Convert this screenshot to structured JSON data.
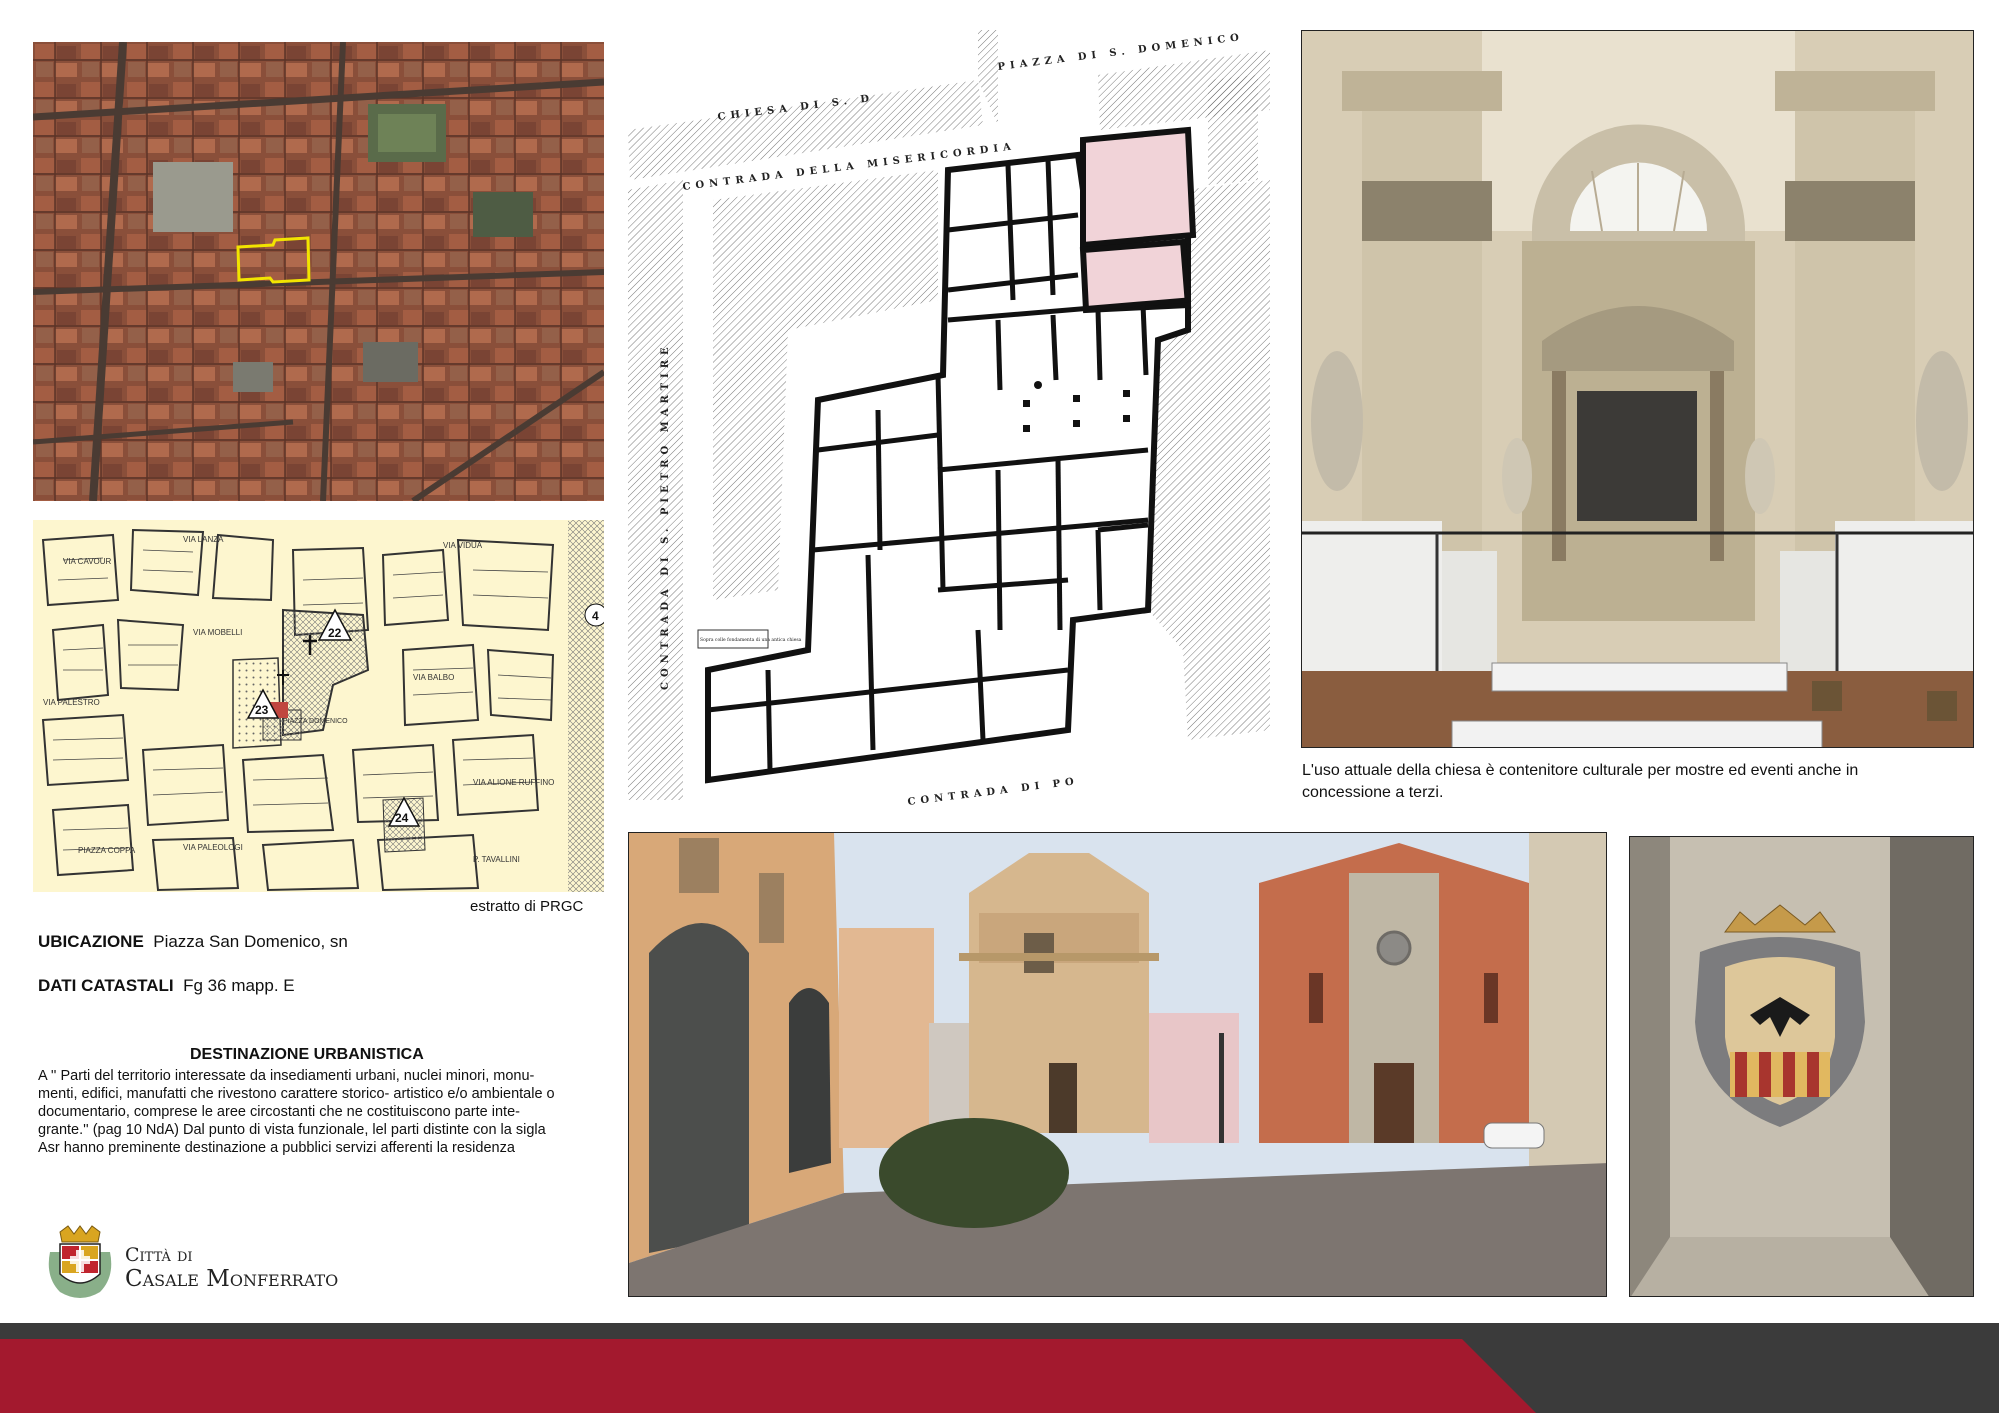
{
  "aerial": {
    "alt": "aerial-view"
  },
  "prgc": {
    "caption": "estratto di PRGC",
    "streets": [
      "VIA LANZA",
      "VIA VIDUA",
      "VIA MOBELLI",
      "VIA PALESTRO",
      "PIAZZA DOMENICO",
      "VIA PALEOLOGI",
      "PIAZZA COPPA",
      "VIA ALIONE RUFFINO",
      "VIA BALBO",
      "P. TAVALLINI",
      "VIA CAVOUR"
    ],
    "markers": [
      "22",
      "23",
      "24",
      "4"
    ]
  },
  "plan": {
    "labels": [
      "CHIESA DI S. D",
      "PIAZZA DI S. DOMENICO",
      "CONTRADA DELLA MISERICORDIA",
      "CONTRADA DI S. PIETRO MARTIRE",
      "CONTRADA DI PO"
    ],
    "note": "Sopra colle fondamenta di una antica chiesa"
  },
  "info": {
    "ubicazione_label": "UBICAZIONE",
    "ubicazione_value": "Piazza San Domenico, sn",
    "catasto_label": "DATI CATASTALI",
    "catasto_value": "Fg 36 mapp. E",
    "destinazione_title": "DESTINAZIONE URBANISTICA",
    "destinazione_lines": [
      "A '' Parti del territorio interessate da insediamenti urbani, nuclei minori, monu-",
      "menti, edifici, manufatti che rivestono carattere storico- artistico e/o ambientale o",
      "documentario, comprese le aree circostanti che ne costituiscono parte inte-",
      "grante.'' (pag 10 NdA) Dal punto di vista funzionale, lel parti distinte con la sigla",
      "Asr hanno preminente destinazione a pubblici servizi afferenti la residenza"
    ]
  },
  "interior_caption_lines": [
    "L'uso attuale della chiesa  è contenitore culturale per mostre ed eventi anche in",
    "concessione a terzi."
  ],
  "logo": {
    "line1": "Città di",
    "line2": "Casale Monferrato"
  },
  "colors": {
    "red_band": "#a3192e",
    "dark_band": "#3b3b3b",
    "highlight_pink": "#f1d3d8",
    "map_yellow": "#fdf6cf",
    "aerial_outline": "#f2e400"
  }
}
